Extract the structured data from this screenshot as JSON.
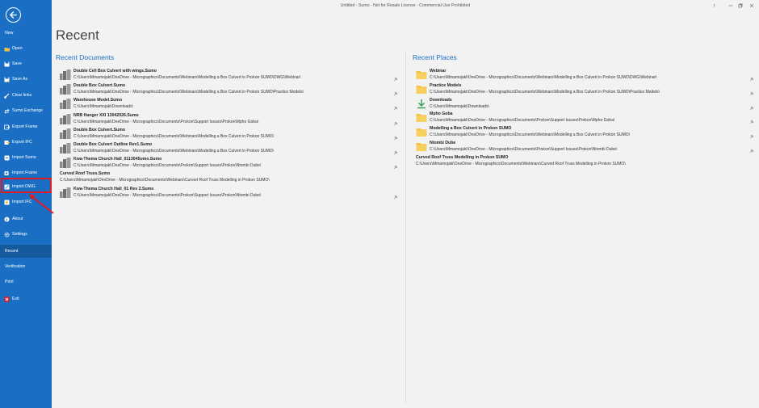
{
  "window": {
    "title": "Untitled - Sumo - Not for Resale License - Commercial Use Prohibited"
  },
  "sidebar": {
    "items": [
      {
        "label": "New",
        "icon": "none"
      },
      {
        "label": "Open",
        "icon": "folder-icon"
      },
      {
        "label": "Save",
        "icon": "save-icon"
      },
      {
        "label": "Save As",
        "icon": "save-as-icon"
      },
      {
        "label": "Clear links",
        "icon": "clear-links-icon"
      },
      {
        "label": "Sumo Exchange",
        "icon": "exchange-icon"
      },
      {
        "label": "Export Frame",
        "icon": "export-frame-icon"
      },
      {
        "label": "Export IFC",
        "icon": "export-ifc-icon"
      },
      {
        "label": "Import Sumo",
        "icon": "import-sumo-icon"
      },
      {
        "label": "Import Frame",
        "icon": "import-frame-icon"
      },
      {
        "label": "Import DWG",
        "icon": "import-dwg-icon"
      },
      {
        "label": "Import IFC",
        "icon": "import-ifc-icon"
      },
      {
        "label": "About",
        "icon": "info-icon"
      },
      {
        "label": "Settings",
        "icon": "gear-icon"
      },
      {
        "label": "Recent",
        "icon": "none"
      },
      {
        "label": "Verification",
        "icon": "none"
      },
      {
        "label": "Print",
        "icon": "none"
      },
      {
        "label": "Exit",
        "icon": "exit-icon"
      }
    ]
  },
  "main": {
    "title": "Recent",
    "recent_documents": {
      "heading": "Recent Documents",
      "items": [
        {
          "name": "Double Cell Box Culvert with wings.Sumo",
          "path": "C:\\Users\\Mmamojaki\\OneDrive - Micrographics\\Documents\\Webinars\\Modelling a Box Culvert in Prokon SUMO\\DWG\\Webinar\\",
          "icon": true
        },
        {
          "name": "Double Box Culvert.Sumo",
          "path": "C:\\Users\\Mmamojaki\\OneDrive - Micrographics\\Documents\\Webinars\\Modelling a Box Culvert in Prokon SUMO\\Practice Models\\",
          "icon": true
        },
        {
          "name": "Warehouse Model.Sumo",
          "path": "C:\\Users\\Mmamojaki\\Downloads\\",
          "icon": true
        },
        {
          "name": "NRB Hanger XXI 13042026.Sumo",
          "path": "C:\\Users\\Mmamojaki\\OneDrive - Micrographics\\Documents\\Prokon\\Support Issues\\Prokon\\Mpho Goba\\",
          "icon": true
        },
        {
          "name": "Double Box Culvert.Sumo",
          "path": "C:\\Users\\Mmamojaki\\OneDrive - Micrographics\\Documents\\Webinars\\Modelling a Box Culvert in Prokon SUMO\\",
          "icon": true
        },
        {
          "name": "Double Box Culvert Outline Rev1.Sumo",
          "path": "C:\\Users\\Mmamojaki\\OneDrive - Micrographics\\Documents\\Webinars\\Modelling a Box Culvert in Prokon SUMO\\",
          "icon": true
        },
        {
          "name": "Kwa-Thema Church Hall_0113045umo.Sumo",
          "path": "C:\\Users\\Mmamojaki\\OneDrive - Micrographics\\Documents\\Prokon\\Support Issues\\Prokon\\Ntombi Dube\\",
          "icon": true
        },
        {
          "name": "Curved Roof Truss.Sumo",
          "path": "C:\\Users\\Mmamojaki\\OneDrive - Micrographics\\Documents\\Webinars\\Curved Roof Truss Modelling in Prokon SUMO\\",
          "icon": false
        },
        {
          "name": "Kwa-Thema Church Hall_01 Rev 2.Sumo",
          "path": "C:\\Users\\Mmamojaki\\OneDrive - Micrographics\\Documents\\Prokon\\Support Issues\\Prokon\\Ntombi Dube\\",
          "icon": true
        }
      ]
    },
    "recent_places": {
      "heading": "Recent Places",
      "items": [
        {
          "name": "Webinar",
          "path": "C:\\Users\\Mmamojaki\\OneDrive - Micrographics\\Documents\\Webinars\\Modelling a Box Culvert in Prokon SUMO\\DWG\\Webinar\\",
          "icon": "folder"
        },
        {
          "name": "Practice Models",
          "path": "C:\\Users\\Mmamojaki\\OneDrive - Micrographics\\Documents\\Webinars\\Modelling a Box Culvert in Prokon SUMO\\Practice Models\\",
          "icon": "folder"
        },
        {
          "name": "Downloads",
          "path": "C:\\Users\\Mmamojaki\\Downloads\\",
          "icon": "download"
        },
        {
          "name": "Mpho Goba",
          "path": "C:\\Users\\Mmamojaki\\OneDrive - Micrographics\\Documents\\Prokon\\Support Issues\\Prokon\\Mpho Goba\\",
          "icon": "folder"
        },
        {
          "name": "Modelling a Box Culvert in Prokon SUMO",
          "path": "C:\\Users\\Mmamojaki\\OneDrive - Micrographics\\Documents\\Webinars\\Modelling a Box Culvert in Prokon SUMO\\",
          "icon": "folder"
        },
        {
          "name": "Ntombi Dube",
          "path": "C:\\Users\\Mmamojaki\\OneDrive - Micrographics\\Documents\\Prokon\\Support Issues\\Prokon\\Ntombi Dube\\",
          "icon": "folder"
        },
        {
          "name": "Curved Roof Truss Modelling in Prokon SUMO",
          "path": "C:\\Users\\Mmamojaki\\OneDrive - Micrographics\\Documents\\Webinars\\Curved Roof Truss Modelling in Prokon SUMO\\",
          "icon": "none"
        }
      ]
    }
  },
  "colors": {
    "sidebar": "#1a6fc4",
    "accent": "#1a6fc4",
    "highlight": "#e01b24",
    "folder": "#f5c342"
  }
}
